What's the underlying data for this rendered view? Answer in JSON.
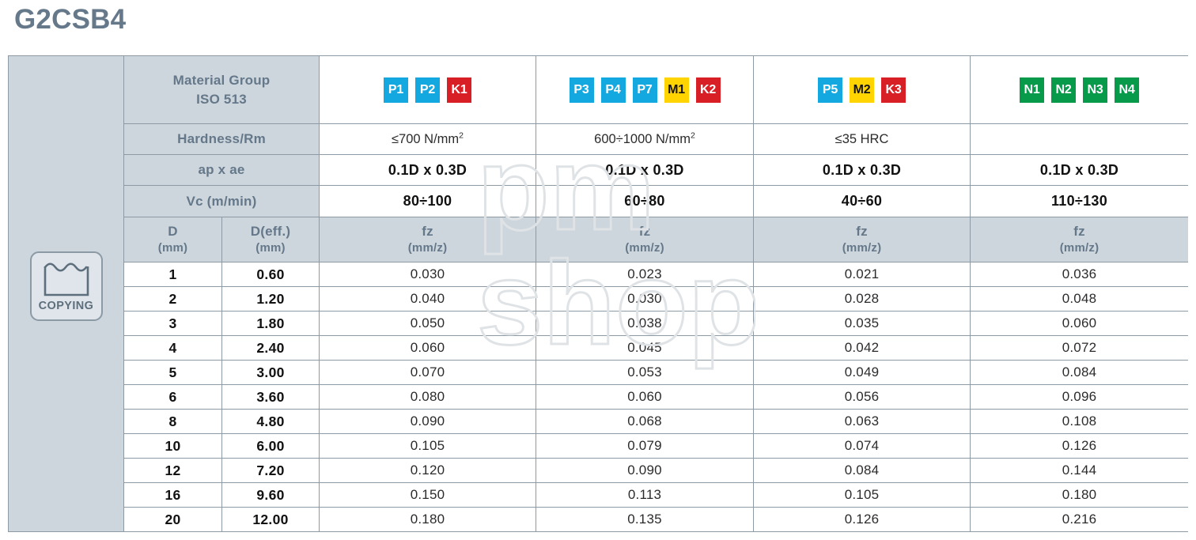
{
  "title": "G2CSB4",
  "watermark": {
    "line1": "pm",
    "line2": "shop"
  },
  "sidebar": {
    "icon_label": "COPYING",
    "icon_name": "copying-wave-icon"
  },
  "row_labels": {
    "material_group": "Material Group\nISO 513",
    "material_group_l1": "Material Group",
    "material_group_l2": "ISO 513",
    "hardness": "Hardness/Rm",
    "ap_ae": "ap x ae",
    "vc": "Vc (m/min)"
  },
  "subheaders": {
    "d_l1": "D",
    "d_l2": "(mm)",
    "deff_l1": "D(eff.)",
    "deff_l2": "(mm)",
    "fz_l1": "fz",
    "fz_l2": "(mm/z)"
  },
  "colors": {
    "p_badge": "#14a8e0",
    "k_badge": "#d81f26",
    "m_badge": "#ffd400",
    "n_badge": "#079a4b",
    "header_fill": "#cdd6dd",
    "header_text": "#65788a",
    "border": "#8e9aa3",
    "title_text": "#66798a"
  },
  "groups": [
    {
      "badges": [
        {
          "label": "P1",
          "kind": "p"
        },
        {
          "label": "P2",
          "kind": "p"
        },
        {
          "label": "K1",
          "kind": "k"
        }
      ],
      "hardness_value": "≤700 N/mm",
      "hardness_sup": "2",
      "ap_ae_value": "0.1D x 0.3D",
      "vc_value": "80÷100",
      "fz_header_l1": "fz",
      "fz_header_l2": "(mm/z)"
    },
    {
      "badges": [
        {
          "label": "P3",
          "kind": "p"
        },
        {
          "label": "P4",
          "kind": "p"
        },
        {
          "label": "P7",
          "kind": "p"
        },
        {
          "label": "M1",
          "kind": "m"
        },
        {
          "label": "K2",
          "kind": "k"
        }
      ],
      "hardness_value": "600÷1000 N/mm",
      "hardness_sup": "2",
      "ap_ae_value": "0.1D x 0.3D",
      "vc_value": "60÷80",
      "fz_header_l1": "fz",
      "fz_header_l2": "(mm/z)"
    },
    {
      "badges": [
        {
          "label": "P5",
          "kind": "p"
        },
        {
          "label": "M2",
          "kind": "m"
        },
        {
          "label": "K3",
          "kind": "k"
        }
      ],
      "hardness_value": "≤35 HRC",
      "hardness_sup": "",
      "ap_ae_value": "0.1D x 0.3D",
      "vc_value": "40÷60",
      "fz_header_l1": "fz",
      "fz_header_l2": "(mm/z)"
    },
    {
      "badges": [
        {
          "label": "N1",
          "kind": "n"
        },
        {
          "label": "N2",
          "kind": "n"
        },
        {
          "label": "N3",
          "kind": "n"
        },
        {
          "label": "N4",
          "kind": "n"
        }
      ],
      "hardness_value": "",
      "hardness_sup": "",
      "ap_ae_value": "0.1D x 0.3D",
      "vc_value": "110÷130",
      "fz_header_l1": "fz",
      "fz_header_l2": "(mm/z)"
    }
  ],
  "rows": [
    {
      "d": "1",
      "deff": "0.60",
      "fz": [
        "0.030",
        "0.023",
        "0.021",
        "0.036"
      ]
    },
    {
      "d": "2",
      "deff": "1.20",
      "fz": [
        "0.040",
        "0.030",
        "0.028",
        "0.048"
      ]
    },
    {
      "d": "3",
      "deff": "1.80",
      "fz": [
        "0.050",
        "0.038",
        "0.035",
        "0.060"
      ]
    },
    {
      "d": "4",
      "deff": "2.40",
      "fz": [
        "0.060",
        "0.045",
        "0.042",
        "0.072"
      ]
    },
    {
      "d": "5",
      "deff": "3.00",
      "fz": [
        "0.070",
        "0.053",
        "0.049",
        "0.084"
      ]
    },
    {
      "d": "6",
      "deff": "3.60",
      "fz": [
        "0.080",
        "0.060",
        "0.056",
        "0.096"
      ]
    },
    {
      "d": "8",
      "deff": "4.80",
      "fz": [
        "0.090",
        "0.068",
        "0.063",
        "0.108"
      ]
    },
    {
      "d": "10",
      "deff": "6.00",
      "fz": [
        "0.105",
        "0.079",
        "0.074",
        "0.126"
      ]
    },
    {
      "d": "12",
      "deff": "7.20",
      "fz": [
        "0.120",
        "0.090",
        "0.084",
        "0.144"
      ]
    },
    {
      "d": "16",
      "deff": "9.60",
      "fz": [
        "0.150",
        "0.113",
        "0.105",
        "0.180"
      ]
    },
    {
      "d": "20",
      "deff": "12.00",
      "fz": [
        "0.180",
        "0.135",
        "0.126",
        "0.216"
      ]
    }
  ]
}
